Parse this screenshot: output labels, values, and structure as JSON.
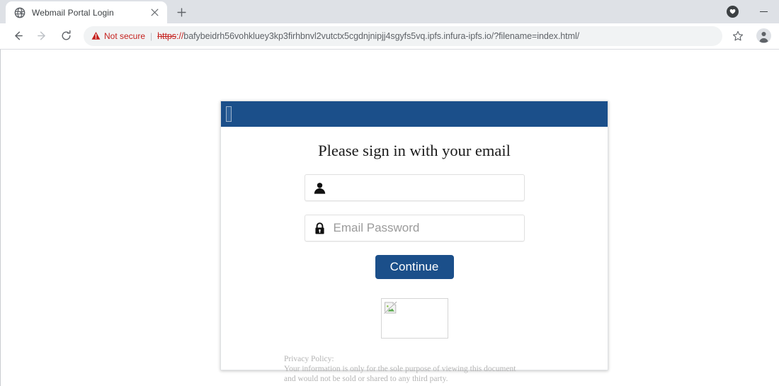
{
  "browser": {
    "tab": {
      "favicon": "globe-icon",
      "title": "Webmail Portal Login",
      "close_label": "×"
    },
    "newtab_label": "+",
    "window_controls": {
      "extension_icon": "heart-circle-icon",
      "minimize_label": "minimize"
    },
    "nav": {
      "back": "back-arrow-icon",
      "forward": "forward-arrow-icon",
      "reload": "reload-icon"
    },
    "omnibox": {
      "security_icon": "warning-triangle-icon",
      "security_text": "Not secure",
      "separator": "|",
      "url_scheme": "https",
      "url_scheme_sep": "://",
      "url_rest": "bafybeidrh56vohkluey3kp3firhbnvl2vutctx5cgdnjnipjj4sgyfs5vq.ipfs.infura-ipfs.io/?filename=index.html/",
      "url_full": "https://bafybeidrh56vohkluey3kp3firhbnvl2vutctx5cgdnjnipjj4sgyfs5vq.ipfs.infura-ipfs.io/?filename=index.html/"
    },
    "bookmark_icon": "star-icon",
    "profile_icon": "avatar-icon"
  },
  "page": {
    "header": {
      "logo_alt": "broken-image-placeholder"
    },
    "title": "Please sign in with your email",
    "fields": {
      "email": {
        "icon": "person-icon",
        "value": "",
        "placeholder": ""
      },
      "password": {
        "icon": "lock-icon",
        "value": "",
        "placeholder": "Email Password"
      }
    },
    "submit_label": "Continue",
    "broken_image": {
      "alt": "broken-image-placeholder"
    },
    "privacy": {
      "heading": "Privacy Policy:",
      "line1": "Your information is only for the sole purpose of viewing this document",
      "line2": "and would not be sold or shared to any third party."
    }
  },
  "colors": {
    "brand_blue": "#1b4f8a",
    "tabstrip": "#dee1e6",
    "omnibox_bg": "#f1f3f4",
    "warning_red": "#c5221f",
    "placeholder_gray": "#9b9b9b",
    "privacy_gray": "#b3b3b3"
  }
}
